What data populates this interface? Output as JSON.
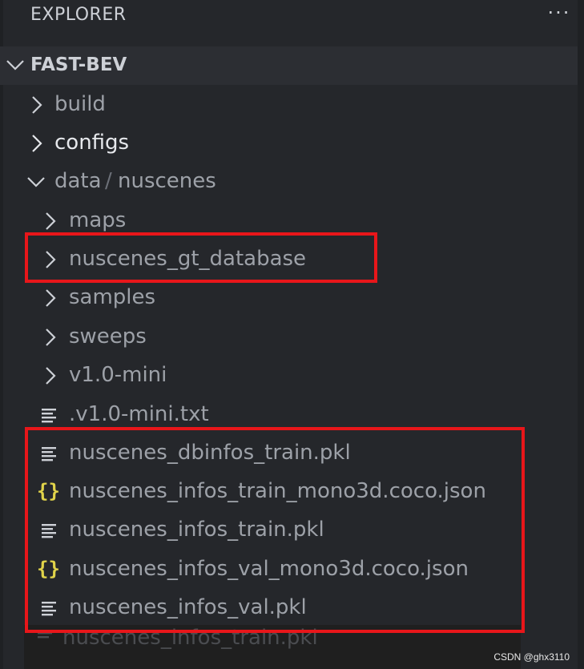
{
  "header": {
    "title": "EXPLORER",
    "more_label": "···"
  },
  "section": {
    "title": "FAST-BEV"
  },
  "tree": {
    "build": "build",
    "configs": "configs",
    "data_parent": "data",
    "data_sep": "/",
    "data_child": "nuscenes",
    "maps": "maps",
    "gt_database": "nuscenes_gt_database",
    "samples": "samples",
    "sweeps": "sweeps",
    "v10mini": "v1.0-mini",
    "v10mini_txt": ".v1.0-mini.txt",
    "dbinfos_train": "nuscenes_dbinfos_train.pkl",
    "infos_train_mono3d": "nuscenes_infos_train_mono3d.coco.json",
    "infos_train": "nuscenes_infos_train.pkl",
    "infos_val_mono3d": "nuscenes_infos_val_mono3d.coco.json",
    "infos_val": "nuscenes_infos_val.pkl"
  },
  "icons": {
    "json_glyph": "{}",
    "json_color": "#e0d34a",
    "highlight_color": "#e8161a"
  },
  "ghost": {
    "label": "nuscenes_infos_train.pkl"
  },
  "watermark": "CSDN @ghx3110"
}
